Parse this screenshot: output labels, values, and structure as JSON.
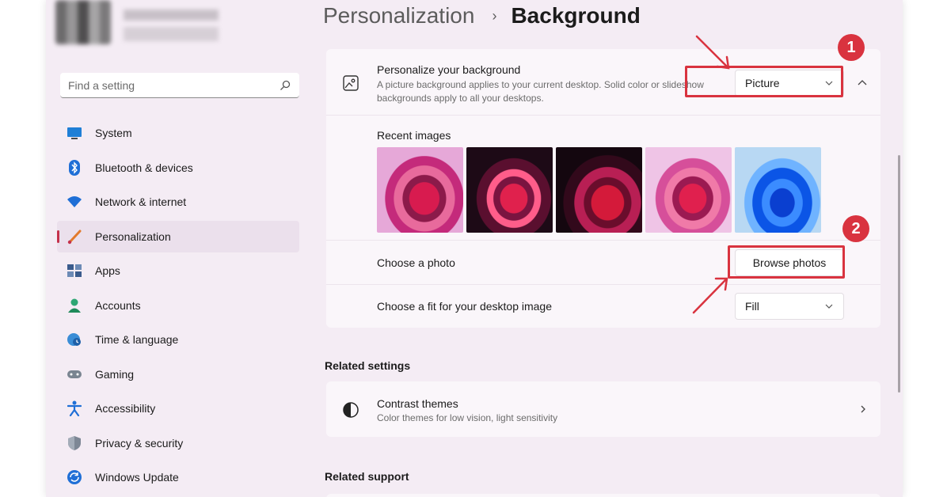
{
  "sidebar": {
    "search_placeholder": "Find a setting",
    "items": [
      {
        "label": "System",
        "icon": "monitor-icon"
      },
      {
        "label": "Bluetooth & devices",
        "icon": "bluetooth-icon"
      },
      {
        "label": "Network & internet",
        "icon": "wifi-icon"
      },
      {
        "label": "Personalization",
        "icon": "brush-icon",
        "active": true
      },
      {
        "label": "Apps",
        "icon": "apps-icon"
      },
      {
        "label": "Accounts",
        "icon": "person-icon"
      },
      {
        "label": "Time & language",
        "icon": "globe-clock-icon"
      },
      {
        "label": "Gaming",
        "icon": "gamepad-icon"
      },
      {
        "label": "Accessibility",
        "icon": "accessibility-icon"
      },
      {
        "label": "Privacy & security",
        "icon": "shield-icon"
      },
      {
        "label": "Windows Update",
        "icon": "update-icon"
      }
    ]
  },
  "breadcrumb": {
    "parent": "Personalization",
    "separator": "›",
    "current": "Background"
  },
  "background_card": {
    "title": "Personalize your background",
    "description": "A picture background applies to your current desktop. Solid color or slideshow backgrounds apply to all your desktops.",
    "selected_type": "Picture",
    "recent_images_label": "Recent images",
    "choose_photo_label": "Choose a photo",
    "browse_button": "Browse photos",
    "fit_label": "Choose a fit for your desktop image",
    "fit_value": "Fill"
  },
  "related_settings": {
    "title": "Related settings",
    "contrast_title": "Contrast themes",
    "contrast_desc": "Color themes for low vision, light sensitivity"
  },
  "related_support": {
    "title": "Related support"
  },
  "annotations": {
    "step1": "1",
    "step2": "2"
  },
  "colors": {
    "accent": "#c4314b",
    "annotation": "#d9333f",
    "window_bg": "#f4ecf4"
  }
}
